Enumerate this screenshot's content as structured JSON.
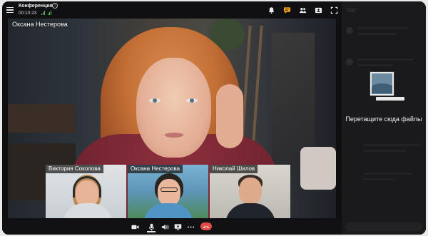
{
  "header": {
    "title": "Конференция",
    "timer": "00:10:23"
  },
  "top_icons": [
    "bell-icon",
    "chat-icon",
    "participants-icon",
    "present-icon",
    "fullscreen-icon"
  ],
  "main_video": {
    "name": "Оксана Нестерова"
  },
  "participants": [
    {
      "name": "Виктория Соколова"
    },
    {
      "name": "Оксана Нестерова"
    },
    {
      "name": "Николай Шилов"
    }
  ],
  "toolbar": {
    "icons": [
      "camera-icon",
      "microphone-icon",
      "speaker-icon",
      "screen-share-icon",
      "more-icon",
      "hangup-icon"
    ]
  },
  "chat_panel": {
    "title": "Чат",
    "drop_text": "Перетащите сюда файлы"
  },
  "colors": {
    "accent_active": "#f5a623",
    "signal": "#5cc35c",
    "hangup": "#e24a47",
    "background": "#0f0f10"
  }
}
